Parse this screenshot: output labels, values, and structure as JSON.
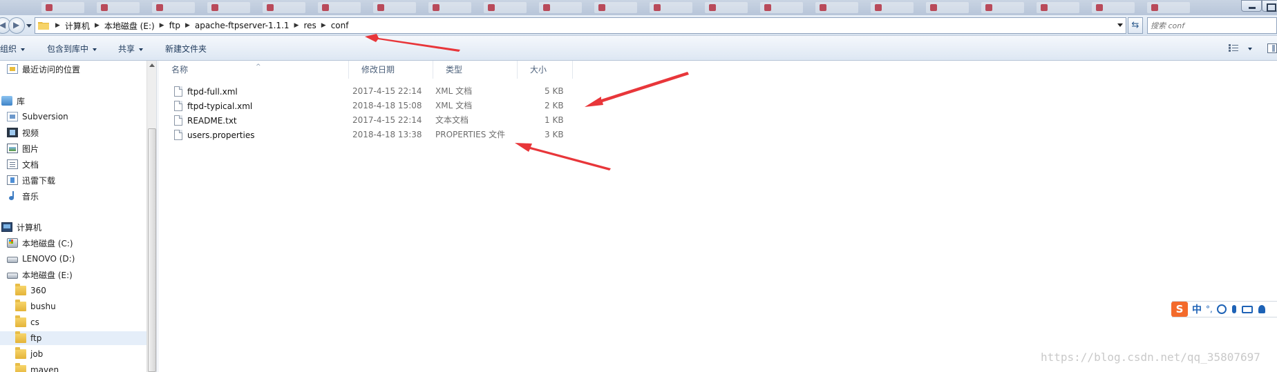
{
  "address": {
    "crumbs": [
      "计算机",
      "本地磁盘 (E:)",
      "ftp",
      "apache-ftpserver-1.1.1",
      "res",
      "conf"
    ]
  },
  "search": {
    "placeholder": "搜索 conf"
  },
  "toolbar": {
    "organize": "组织",
    "include_in_library": "包含到库中",
    "share": "共享",
    "new_folder": "新建文件夹"
  },
  "nav": {
    "recent": "最近访问的位置",
    "libraries": "库",
    "subversion": "Subversion",
    "videos": "视频",
    "pictures": "图片",
    "documents": "文档",
    "thunder": "迅雷下载",
    "music": "音乐",
    "computer": "计算机",
    "drive_c": "本地磁盘 (C:)",
    "drive_d": "LENOVO (D:)",
    "drive_e": "本地磁盘 (E:)",
    "folders": [
      "360",
      "bushu",
      "cs",
      "ftp",
      "job",
      "maven"
    ]
  },
  "columns": {
    "name": "名称",
    "modified": "修改日期",
    "type": "类型",
    "size": "大小"
  },
  "files": [
    {
      "name": "ftpd-full.xml",
      "modified": "2017-4-15 22:14",
      "type": "XML 文档",
      "size": "5 KB"
    },
    {
      "name": "ftpd-typical.xml",
      "modified": "2018-4-18 15:08",
      "type": "XML 文档",
      "size": "2 KB"
    },
    {
      "name": "README.txt",
      "modified": "2017-4-15 22:14",
      "type": "文本文档",
      "size": "1 KB"
    },
    {
      "name": "users.properties",
      "modified": "2018-4-18 13:38",
      "type": "PROPERTIES 文件",
      "size": "3 KB"
    }
  ],
  "ime": {
    "logo": "S",
    "mode": "中",
    "punct": "°,"
  },
  "watermark": "https://blog.csdn.net/qq_35807697",
  "colors": {
    "annotation_arrow": "#e8363a",
    "selection": "#e5eef9",
    "ime_brand": "#f36a2b"
  },
  "icons": [
    "back-icon",
    "forward-icon",
    "folder-icon",
    "refresh-icon",
    "file-icon",
    "view-icon",
    "preview-pane-icon"
  ]
}
